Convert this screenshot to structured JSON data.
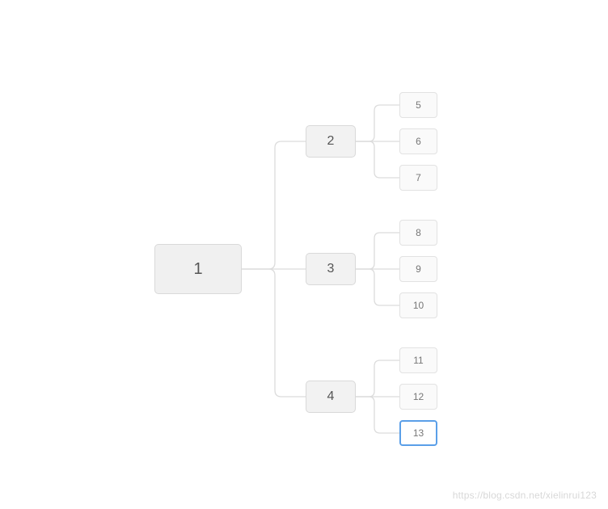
{
  "tree": {
    "root": {
      "label": "1"
    },
    "level2": [
      {
        "label": "2"
      },
      {
        "label": "3"
      },
      {
        "label": "4"
      }
    ],
    "level3": [
      {
        "label": "5"
      },
      {
        "label": "6"
      },
      {
        "label": "7"
      },
      {
        "label": "8"
      },
      {
        "label": "9"
      },
      {
        "label": "10"
      },
      {
        "label": "11"
      },
      {
        "label": "12"
      },
      {
        "label": "13",
        "selected": true
      }
    ]
  },
  "watermark": "https://blog.csdn.net/xielinrui123"
}
